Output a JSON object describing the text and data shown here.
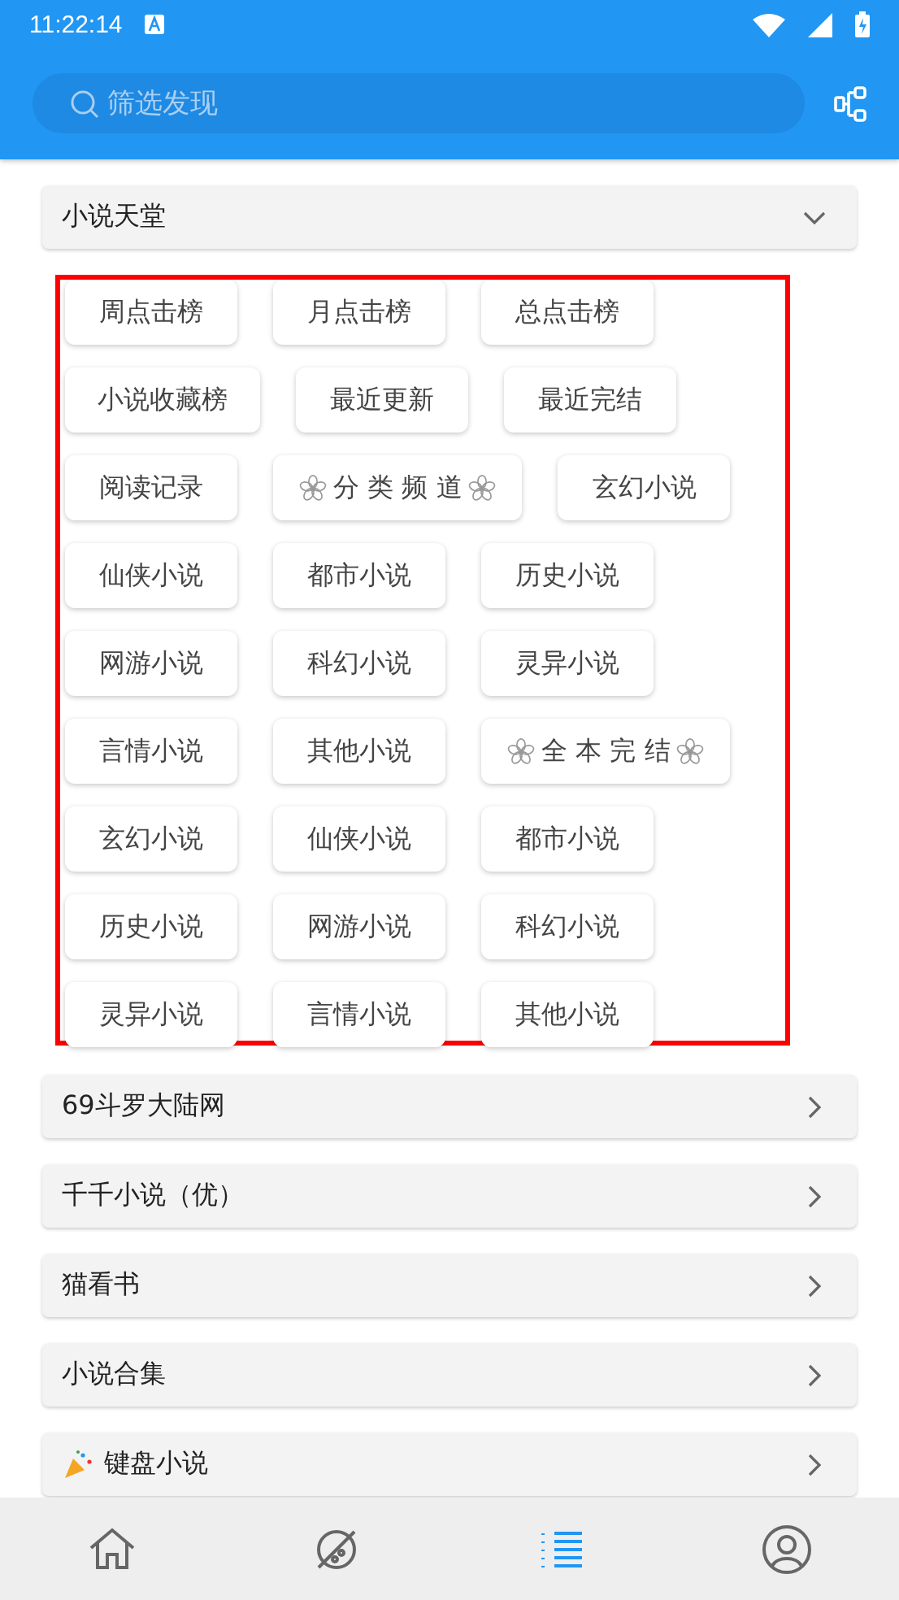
{
  "status_bar": {
    "time": "11:22:14"
  },
  "search": {
    "placeholder": "筛选发现"
  },
  "sections": [
    {
      "title": "小说天堂",
      "expanded": true,
      "icon": false,
      "highlighted": true,
      "tags": [
        {
          "label": "周点击榜",
          "kind": "plain"
        },
        {
          "label": "月点击榜",
          "kind": "plain"
        },
        {
          "label": "总点击榜",
          "kind": "plain"
        },
        {
          "label": "小说收藏榜",
          "kind": "plain"
        },
        {
          "label": "最近更新",
          "kind": "plain"
        },
        {
          "label": "最近完结",
          "kind": "plain"
        },
        {
          "label": "阅读记录",
          "kind": "plain"
        },
        {
          "label": "分 类 频 道",
          "kind": "special"
        },
        {
          "label": "玄幻小说",
          "kind": "plain"
        },
        {
          "label": "仙侠小说",
          "kind": "plain"
        },
        {
          "label": "都市小说",
          "kind": "plain"
        },
        {
          "label": "历史小说",
          "kind": "plain"
        },
        {
          "label": "网游小说",
          "kind": "plain"
        },
        {
          "label": "科幻小说",
          "kind": "plain"
        },
        {
          "label": "灵异小说",
          "kind": "plain"
        },
        {
          "label": "言情小说",
          "kind": "plain"
        },
        {
          "label": "其他小说",
          "kind": "plain"
        },
        {
          "label": "全 本 完 结",
          "kind": "special"
        },
        {
          "label": "玄幻小说",
          "kind": "plain"
        },
        {
          "label": "仙侠小说",
          "kind": "plain"
        },
        {
          "label": "都市小说",
          "kind": "plain"
        },
        {
          "label": "历史小说",
          "kind": "plain"
        },
        {
          "label": "网游小说",
          "kind": "plain"
        },
        {
          "label": "科幻小说",
          "kind": "plain"
        },
        {
          "label": "灵异小说",
          "kind": "plain"
        },
        {
          "label": "言情小说",
          "kind": "plain"
        },
        {
          "label": "其他小说",
          "kind": "plain"
        }
      ]
    },
    {
      "title": "69斗罗大陆网",
      "expanded": false,
      "icon": false
    },
    {
      "title": "千千小说（优）",
      "expanded": false,
      "icon": false
    },
    {
      "title": "猫看书",
      "expanded": false,
      "icon": false
    },
    {
      "title": "小说合集",
      "expanded": false,
      "icon": false
    },
    {
      "title": "键盘小说",
      "expanded": false,
      "icon": true
    }
  ],
  "nav": [
    {
      "kind": "home",
      "selected": false
    },
    {
      "kind": "planet",
      "selected": false
    },
    {
      "kind": "list",
      "selected": true
    },
    {
      "kind": "user",
      "selected": false
    }
  ]
}
